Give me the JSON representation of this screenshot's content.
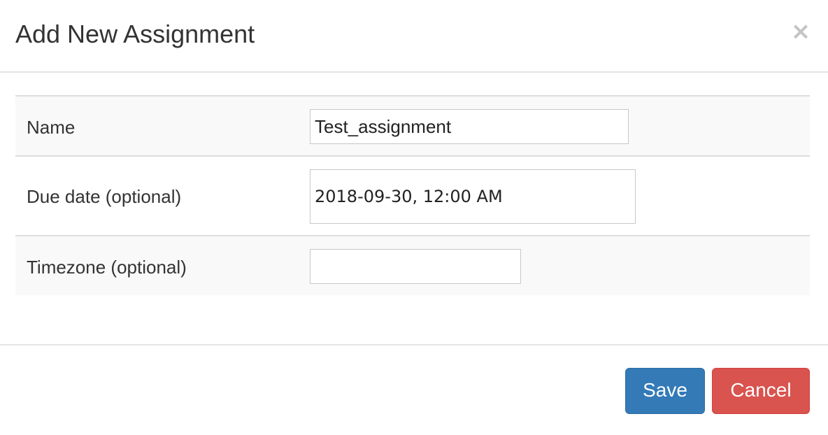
{
  "dialog": {
    "title": "Add New Assignment",
    "close_glyph": "×"
  },
  "form": {
    "rows": [
      {
        "label": "Name",
        "value": "Test_assignment",
        "placeholder": ""
      },
      {
        "label": "Due date (optional)",
        "value": "2018-09-30, 12:00 AM",
        "placeholder": ""
      },
      {
        "label": "Timezone (optional)",
        "value": "",
        "placeholder": ""
      }
    ]
  },
  "footer": {
    "save_label": "Save",
    "cancel_label": "Cancel"
  },
  "colors": {
    "save": "#337ab7",
    "cancel": "#d9534f",
    "stripe": "#f9f9f9"
  },
  "icons": {
    "close": "close-icon"
  }
}
